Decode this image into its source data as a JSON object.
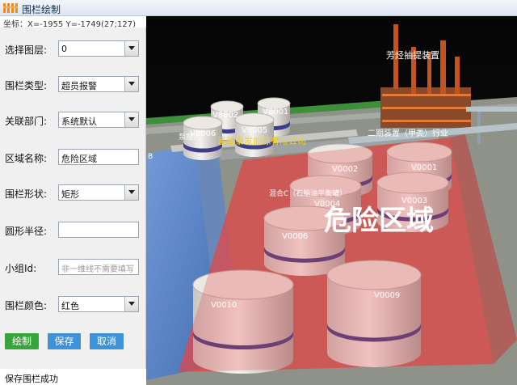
{
  "window": {
    "title": "围栏绘制",
    "coordinates": "坐标：X=-1955  Y=-1749(27;127)"
  },
  "form": {
    "layer_label": "选择图层:",
    "layer_value": "0",
    "fence_type_label": "围栏类型:",
    "fence_type_value": "超员报警",
    "dept_label": "关联部门:",
    "dept_value": "系统默认",
    "area_name_label": "区域名称:",
    "area_name_value": "危险区域",
    "shape_label": "围栏形状:",
    "shape_value": "矩形",
    "radius_label": "圆形半径:",
    "radius_value": "",
    "group_id_label": "小组Id:",
    "group_id_placeholder": "非一维线不需要填写",
    "color_label": "围栏颜色:",
    "color_value": "红色"
  },
  "buttons": {
    "draw": "绘制",
    "save": "保存",
    "cancel": "取消"
  },
  "status": "保存围栏成功",
  "scene": {
    "fence_label": "危险区域",
    "plant_label": "芳烃抽提装置",
    "company_label": "晋瑞泰发能源有限公司",
    "unit_label": "二期装置（甲类）行业",
    "mid_label": "混合C（石脑油平衡罐）",
    "side_label": "泵棚区",
    "edge_label": "B",
    "tank_labels": [
      "V8002",
      "V8001",
      "V8006",
      "V8005",
      "V0002",
      "V0001",
      "V0004",
      "V0003",
      "V0006",
      "V0010",
      "V0009"
    ],
    "fence_color": "#e54545",
    "water_color": "#4f7fc9"
  }
}
